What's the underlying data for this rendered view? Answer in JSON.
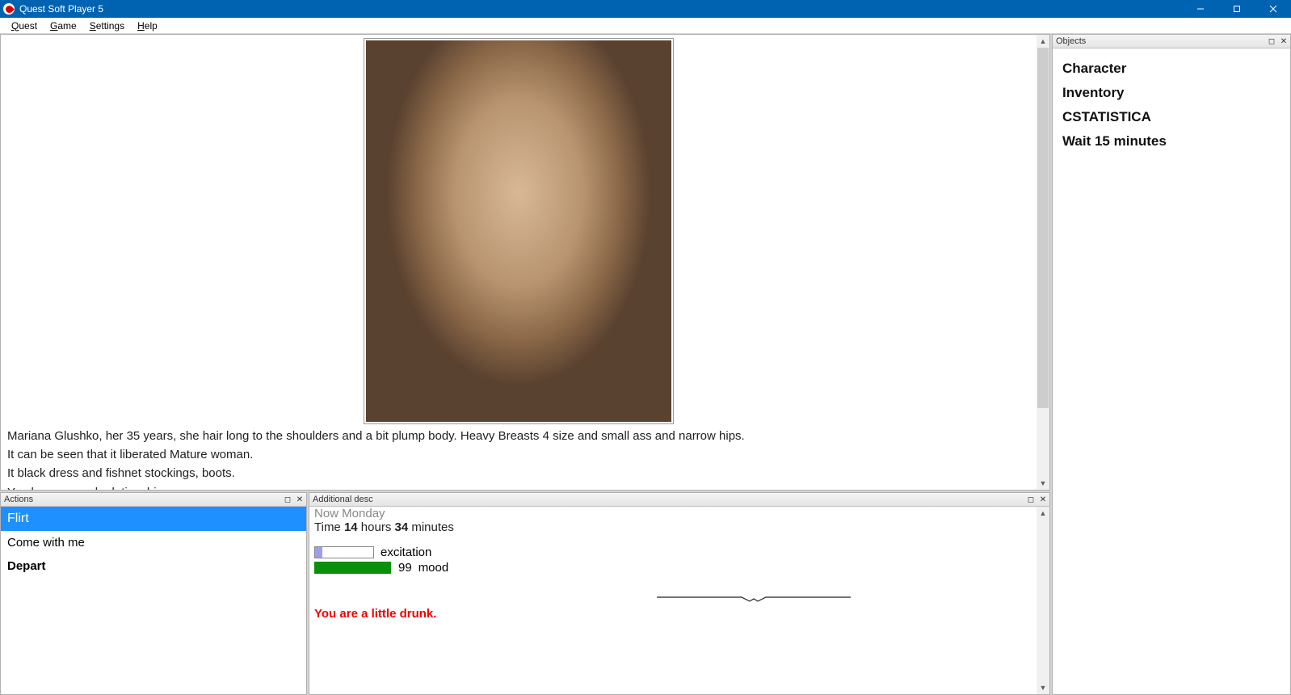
{
  "titlebar": {
    "title": "Quest Soft Player 5"
  },
  "menu": {
    "quest": "Quest",
    "game": "Game",
    "settings": "Settings",
    "help": "Help"
  },
  "main": {
    "desc1": "Mariana Glushko, her 35 years, she hair long to the shoulders and a bit plump body. Heavy Breasts 4 size and small ass and narrow hips.",
    "desc2": "It can be seen that it liberated Mature woman.",
    "desc3": "It black dress and fishnet stockings, boots.",
    "desc4": "You have a good relationship"
  },
  "objects": {
    "header": "Objects",
    "items": [
      "Character",
      "Inventory",
      "CSTATISTICA",
      "Wait 15 minutes"
    ]
  },
  "actions": {
    "header": "Actions",
    "items": [
      {
        "label": "Flirt",
        "selected": true,
        "bold": false
      },
      {
        "label": "Come with me",
        "selected": false,
        "bold": false
      },
      {
        "label": "Depart",
        "selected": false,
        "bold": true
      }
    ]
  },
  "addl": {
    "header": "Additional desc",
    "now": "Now Monday",
    "time_prefix": "Time ",
    "hours": "14",
    "hours_label": " hours ",
    "minutes": "34",
    "minutes_label": " minutes",
    "excitation_label": "excitation",
    "excitation_pct": 12,
    "mood_value": "99",
    "mood_label": "mood",
    "mood_pct": 99,
    "drunk": "You are a little drunk."
  }
}
